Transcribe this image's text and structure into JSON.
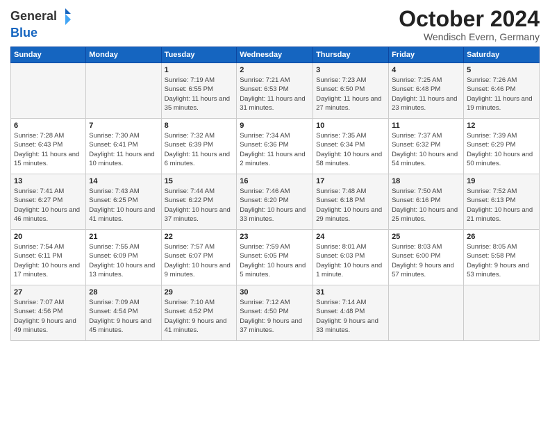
{
  "logo": {
    "general": "General",
    "blue": "Blue"
  },
  "title": "October 2024",
  "location": "Wendisch Evern, Germany",
  "days_header": [
    "Sunday",
    "Monday",
    "Tuesday",
    "Wednesday",
    "Thursday",
    "Friday",
    "Saturday"
  ],
  "weeks": [
    [
      {
        "day": "",
        "detail": ""
      },
      {
        "day": "",
        "detail": ""
      },
      {
        "day": "1",
        "detail": "Sunrise: 7:19 AM\nSunset: 6:55 PM\nDaylight: 11 hours\nand 35 minutes."
      },
      {
        "day": "2",
        "detail": "Sunrise: 7:21 AM\nSunset: 6:53 PM\nDaylight: 11 hours\nand 31 minutes."
      },
      {
        "day": "3",
        "detail": "Sunrise: 7:23 AM\nSunset: 6:50 PM\nDaylight: 11 hours\nand 27 minutes."
      },
      {
        "day": "4",
        "detail": "Sunrise: 7:25 AM\nSunset: 6:48 PM\nDaylight: 11 hours\nand 23 minutes."
      },
      {
        "day": "5",
        "detail": "Sunrise: 7:26 AM\nSunset: 6:46 PM\nDaylight: 11 hours\nand 19 minutes."
      }
    ],
    [
      {
        "day": "6",
        "detail": "Sunrise: 7:28 AM\nSunset: 6:43 PM\nDaylight: 11 hours\nand 15 minutes."
      },
      {
        "day": "7",
        "detail": "Sunrise: 7:30 AM\nSunset: 6:41 PM\nDaylight: 11 hours\nand 10 minutes."
      },
      {
        "day": "8",
        "detail": "Sunrise: 7:32 AM\nSunset: 6:39 PM\nDaylight: 11 hours\nand 6 minutes."
      },
      {
        "day": "9",
        "detail": "Sunrise: 7:34 AM\nSunset: 6:36 PM\nDaylight: 11 hours\nand 2 minutes."
      },
      {
        "day": "10",
        "detail": "Sunrise: 7:35 AM\nSunset: 6:34 PM\nDaylight: 10 hours\nand 58 minutes."
      },
      {
        "day": "11",
        "detail": "Sunrise: 7:37 AM\nSunset: 6:32 PM\nDaylight: 10 hours\nand 54 minutes."
      },
      {
        "day": "12",
        "detail": "Sunrise: 7:39 AM\nSunset: 6:29 PM\nDaylight: 10 hours\nand 50 minutes."
      }
    ],
    [
      {
        "day": "13",
        "detail": "Sunrise: 7:41 AM\nSunset: 6:27 PM\nDaylight: 10 hours\nand 46 minutes."
      },
      {
        "day": "14",
        "detail": "Sunrise: 7:43 AM\nSunset: 6:25 PM\nDaylight: 10 hours\nand 41 minutes."
      },
      {
        "day": "15",
        "detail": "Sunrise: 7:44 AM\nSunset: 6:22 PM\nDaylight: 10 hours\nand 37 minutes."
      },
      {
        "day": "16",
        "detail": "Sunrise: 7:46 AM\nSunset: 6:20 PM\nDaylight: 10 hours\nand 33 minutes."
      },
      {
        "day": "17",
        "detail": "Sunrise: 7:48 AM\nSunset: 6:18 PM\nDaylight: 10 hours\nand 29 minutes."
      },
      {
        "day": "18",
        "detail": "Sunrise: 7:50 AM\nSunset: 6:16 PM\nDaylight: 10 hours\nand 25 minutes."
      },
      {
        "day": "19",
        "detail": "Sunrise: 7:52 AM\nSunset: 6:13 PM\nDaylight: 10 hours\nand 21 minutes."
      }
    ],
    [
      {
        "day": "20",
        "detail": "Sunrise: 7:54 AM\nSunset: 6:11 PM\nDaylight: 10 hours\nand 17 minutes."
      },
      {
        "day": "21",
        "detail": "Sunrise: 7:55 AM\nSunset: 6:09 PM\nDaylight: 10 hours\nand 13 minutes."
      },
      {
        "day": "22",
        "detail": "Sunrise: 7:57 AM\nSunset: 6:07 PM\nDaylight: 10 hours\nand 9 minutes."
      },
      {
        "day": "23",
        "detail": "Sunrise: 7:59 AM\nSunset: 6:05 PM\nDaylight: 10 hours\nand 5 minutes."
      },
      {
        "day": "24",
        "detail": "Sunrise: 8:01 AM\nSunset: 6:03 PM\nDaylight: 10 hours\nand 1 minute."
      },
      {
        "day": "25",
        "detail": "Sunrise: 8:03 AM\nSunset: 6:00 PM\nDaylight: 9 hours\nand 57 minutes."
      },
      {
        "day": "26",
        "detail": "Sunrise: 8:05 AM\nSunset: 5:58 PM\nDaylight: 9 hours\nand 53 minutes."
      }
    ],
    [
      {
        "day": "27",
        "detail": "Sunrise: 7:07 AM\nSunset: 4:56 PM\nDaylight: 9 hours\nand 49 minutes."
      },
      {
        "day": "28",
        "detail": "Sunrise: 7:09 AM\nSunset: 4:54 PM\nDaylight: 9 hours\nand 45 minutes."
      },
      {
        "day": "29",
        "detail": "Sunrise: 7:10 AM\nSunset: 4:52 PM\nDaylight: 9 hours\nand 41 minutes."
      },
      {
        "day": "30",
        "detail": "Sunrise: 7:12 AM\nSunset: 4:50 PM\nDaylight: 9 hours\nand 37 minutes."
      },
      {
        "day": "31",
        "detail": "Sunrise: 7:14 AM\nSunset: 4:48 PM\nDaylight: 9 hours\nand 33 minutes."
      },
      {
        "day": "",
        "detail": ""
      },
      {
        "day": "",
        "detail": ""
      }
    ]
  ]
}
